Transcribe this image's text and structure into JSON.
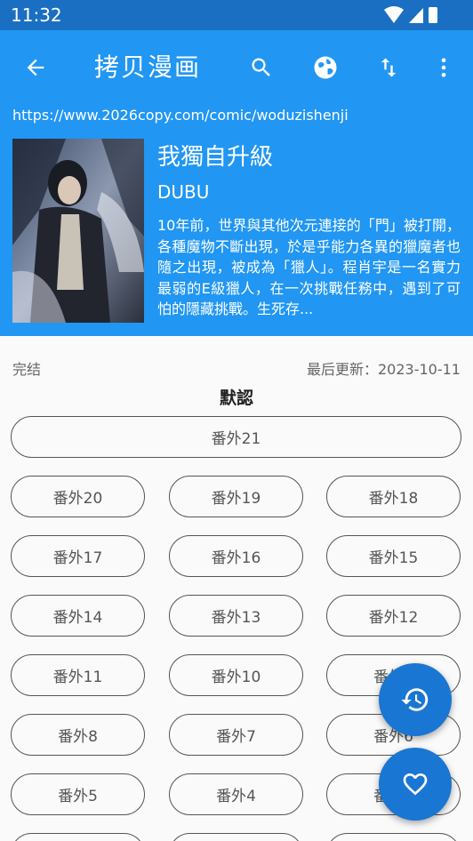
{
  "status_bar": {
    "time": "11:32"
  },
  "app_bar": {
    "title": "拷贝漫画",
    "back_icon": "arrow-left-icon",
    "actions": [
      "search-icon",
      "globe-icon",
      "sort-icon",
      "more-vert-icon"
    ]
  },
  "comic": {
    "url": "https://www.2026copy.com/comic/woduzishenji",
    "title": "我獨自升級",
    "author": "DUBU",
    "description": "10年前，世界與其他次元連接的「門」被打開，各種魔物不斷出現，於是乎能力各異的獵魔者也隨之出現，被成為「獵人」。程肖宇是一名實力最弱的E級獵人，在一次挑戰任務中，遇到了可怕的隱藏挑戰。生死存..."
  },
  "info": {
    "status": "完结",
    "last_update": "最后更新：2023-10-11"
  },
  "group_name": "默認",
  "chapters": [
    "番外21",
    "番外20",
    "番外19",
    "番外18",
    "番外17",
    "番外16",
    "番外15",
    "番外14",
    "番外13",
    "番外12",
    "番外11",
    "番外10",
    "番外9",
    "番外8",
    "番外7",
    "番外6",
    "番外5",
    "番外4",
    "番外3",
    "",
    "",
    ""
  ],
  "fabs": [
    "history-icon",
    "heart-icon"
  ],
  "colors": {
    "primary": "#2196f3",
    "status_bar": "#1a6fc2",
    "fab": "#1976d2"
  }
}
